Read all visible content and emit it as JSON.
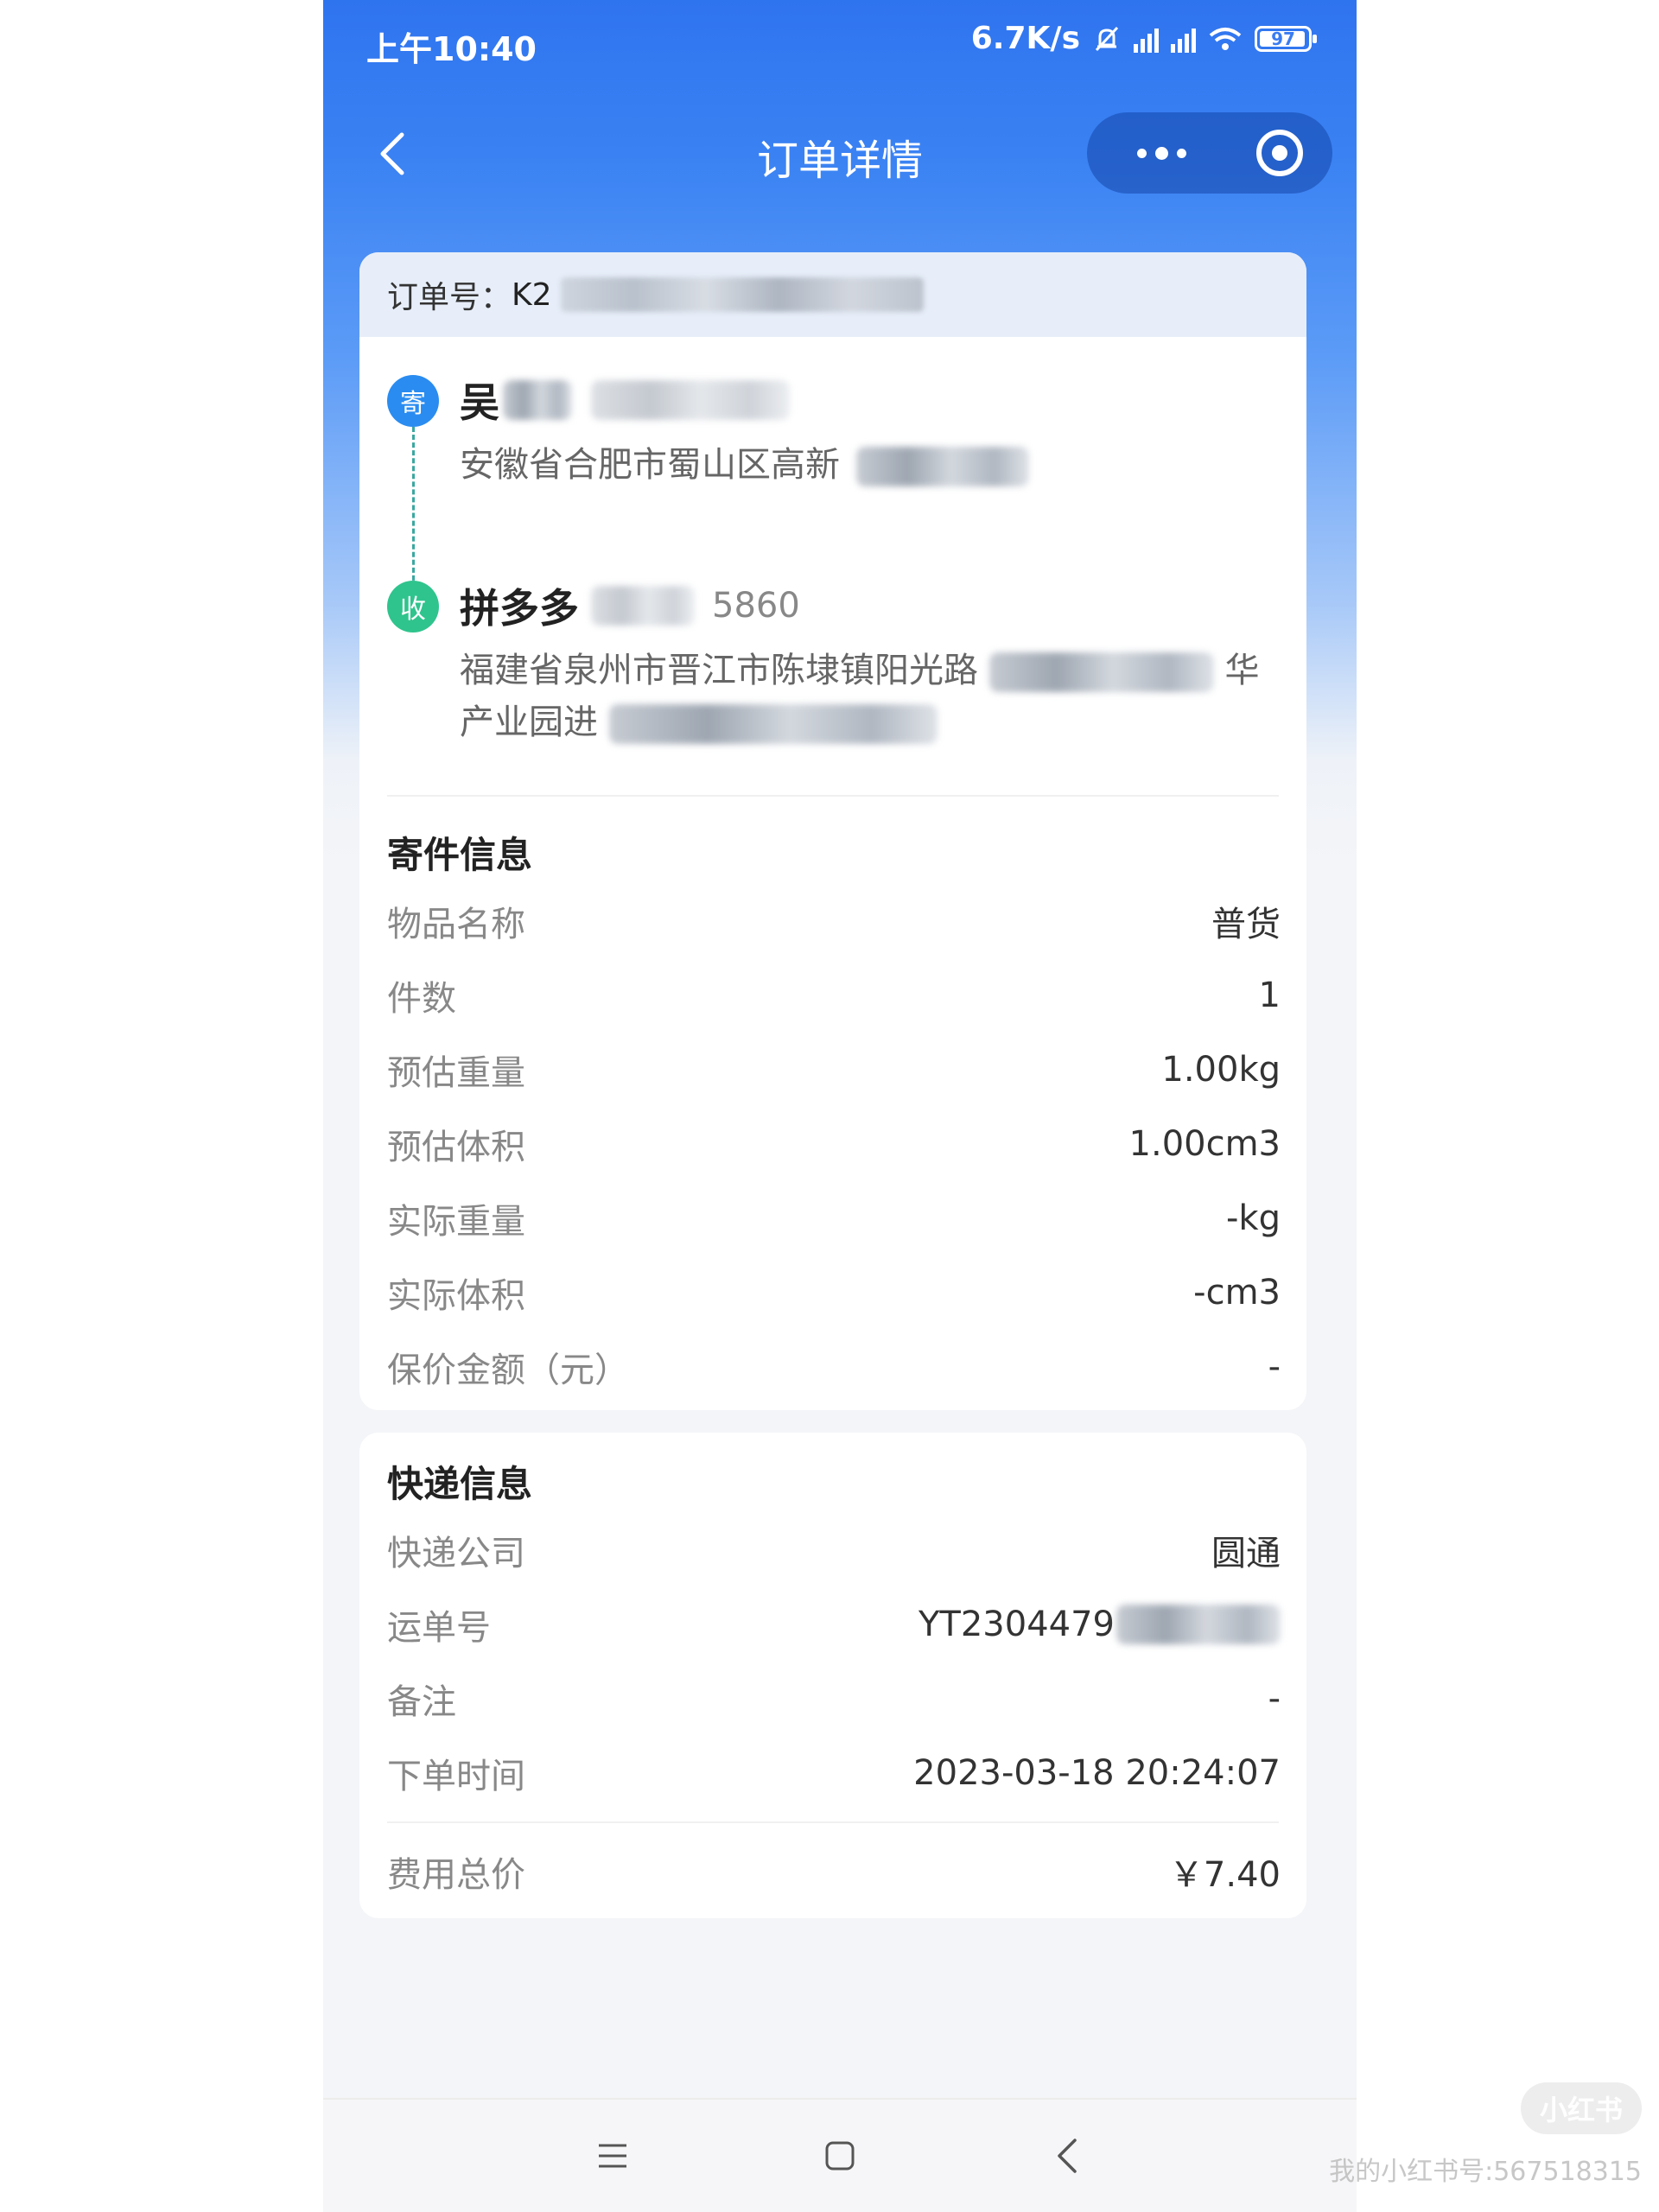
{
  "status_bar": {
    "time": "上午10:40",
    "net_speed": "6.7K/s",
    "battery": "97"
  },
  "header": {
    "title": "订单详情"
  },
  "order": {
    "label": "订单号：",
    "visible_prefix": "K2"
  },
  "sender": {
    "badge": "寄",
    "name_visible": "吴",
    "address_visible": "安徽省合肥市蜀山区高新"
  },
  "receiver": {
    "badge": "收",
    "name_visible": "拼多多",
    "phone_visible": "5860",
    "address_line1_visible": "福建省泉州市晋江市陈埭镇阳光路",
    "address_line1_tail": "华",
    "address_line2_visible": "产业园进"
  },
  "shipment_info": {
    "title": "寄件信息",
    "rows": [
      {
        "label": "物品名称",
        "value": "普货"
      },
      {
        "label": "件数",
        "value": "1"
      },
      {
        "label": "预估重量",
        "value": "1.00kg"
      },
      {
        "label": "预估体积",
        "value": "1.00cm3"
      },
      {
        "label": "实际重量",
        "value": "-kg"
      },
      {
        "label": "实际体积",
        "value": "-cm3"
      },
      {
        "label": "保价金额（元）",
        "value": "-"
      }
    ]
  },
  "express_info": {
    "title": "快递信息",
    "rows": [
      {
        "label": "快递公司",
        "value": "圆通"
      },
      {
        "label": "运单号",
        "value": "YT2304479"
      },
      {
        "label": "备注",
        "value": "-"
      },
      {
        "label": "下单时间",
        "value": "2023-03-18 20:24:07"
      }
    ],
    "total_label": "费用总价",
    "total_value": "￥7.40"
  },
  "watermark": {
    "logo": "小红书",
    "text": "我的小红书号:567518315"
  },
  "icons": [
    "back-arrow-icon",
    "more-dots-icon",
    "target-circle-icon",
    "menu-icon",
    "home-square-icon",
    "nav-back-icon"
  ]
}
